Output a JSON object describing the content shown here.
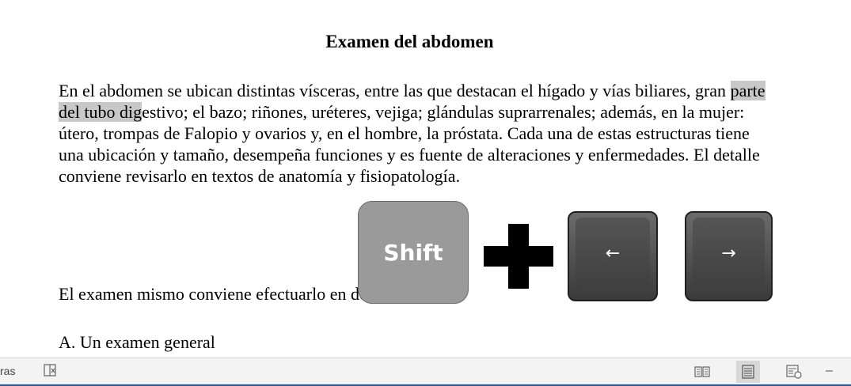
{
  "document": {
    "title": "Examen del abdomen",
    "paragraph1": {
      "before": "En el abdomen se ubican distintas vísceras, entre las que destacan el hígado y vías biliares, gran ",
      "highlight": "parte del tubo dig",
      "after": "estivo; el bazo; riñones, uréteres, vejiga; glándulas suprarrenales; además, en la mujer: útero, trompas de Falopio y ovarios y, en el hombre, la próstata. Cada una de estas estructuras tiene una ubicación y tamaño, desempeña funciones y es fuente de alteraciones y enfermedades. El detalle conviene revisarlo en textos de anatomía y fisiopatología."
    },
    "paragraph2": "El examen mismo conviene efectuarlo en dos etapas:",
    "paragraph3": "A. Un examen general"
  },
  "overlay": {
    "shift_label": "Shift",
    "left_arrow": "←",
    "right_arrow": "→"
  },
  "statusbar": {
    "words_label": "ras",
    "proofing_icon": "proofing-icon",
    "read_mode_icon": "read-mode-icon",
    "print_layout_icon": "print-layout-icon",
    "web_layout_icon": "web-layout-icon",
    "zoom_minus": "–"
  }
}
